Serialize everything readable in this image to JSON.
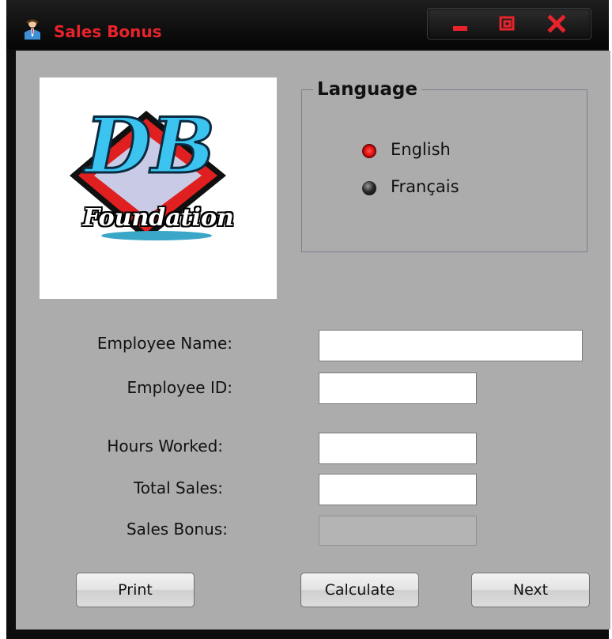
{
  "window": {
    "title": "Sales Bonus",
    "title_color": "#e8232b",
    "title_icon": "user-icon"
  },
  "controls": {
    "minimize_icon": "minimize-icon",
    "maximize_icon": "restore-icon",
    "close_icon": "close-icon"
  },
  "logo": {
    "letters": "DB",
    "word": "Foundation"
  },
  "language": {
    "legend": "Language",
    "options": [
      {
        "label": "English",
        "selected": true
      },
      {
        "label": "Français",
        "selected": false
      }
    ]
  },
  "form": {
    "employee_name": {
      "label": "Employee Name:",
      "value": ""
    },
    "employee_id": {
      "label": "Employee ID:",
      "value": ""
    },
    "hours_worked": {
      "label": "Hours Worked:",
      "value": ""
    },
    "total_sales": {
      "label": "Total Sales:",
      "value": ""
    },
    "sales_bonus": {
      "label": "Sales Bonus:",
      "value": ""
    }
  },
  "buttons": {
    "print": "Print",
    "calculate": "Calculate",
    "next": "Next"
  },
  "colors": {
    "form_background": "#acacac",
    "title_bar": "#0d0d0d",
    "accent_red": "#e31010"
  }
}
